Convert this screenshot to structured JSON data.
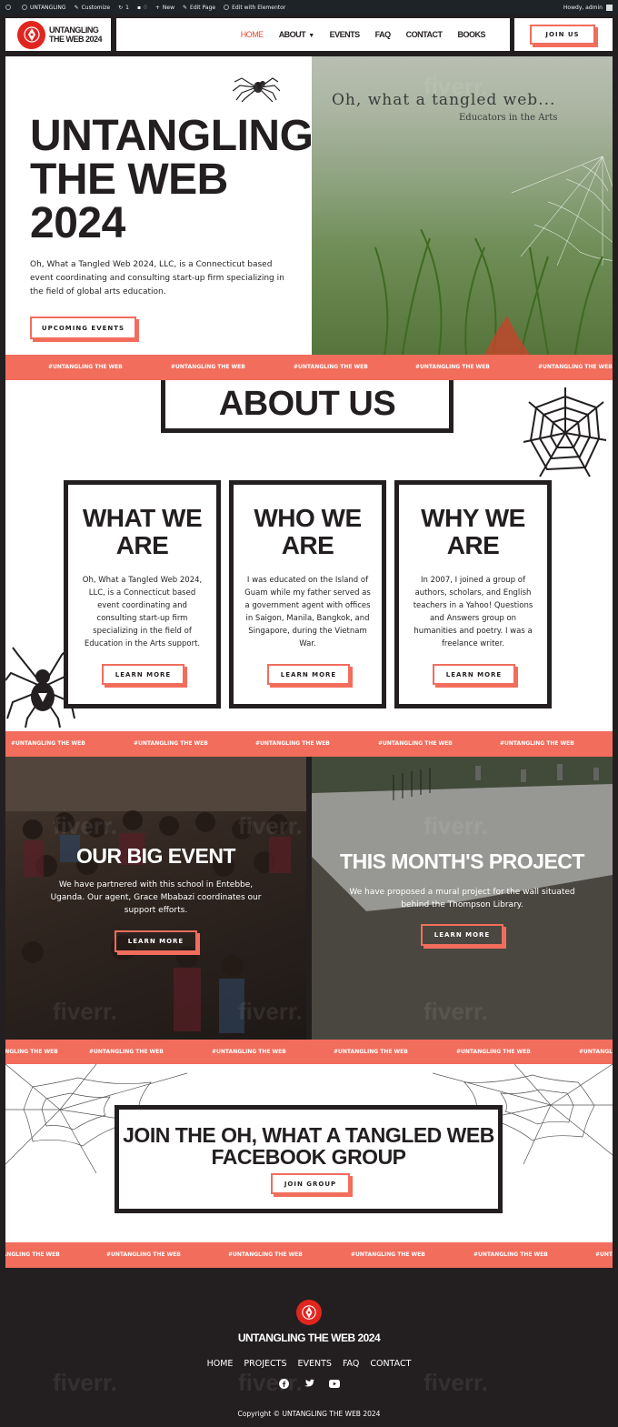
{
  "admin_bar": {
    "site": "UNTANGLING",
    "customize": "Customize",
    "updates": "1",
    "comments": "0",
    "new": "New",
    "edit_page": "Edit Page",
    "edit_elementor": "Edit with Elementor",
    "howdy": "Howdy, admin"
  },
  "header": {
    "logo_line1": "UNTANGLING",
    "logo_line2": "THE WEB 2024",
    "nav": [
      "HOME",
      "ABOUT",
      "EVENTS",
      "FAQ",
      "CONTACT",
      "BOOKS"
    ],
    "join_label": "JOIN US"
  },
  "hero": {
    "title_line1": "UNTANGLING",
    "title_line2": "THE WEB",
    "title_line3": "2024",
    "text": "Oh, What a Tangled Web 2024, LLC, is a Connecticut based event coordinating and consulting start-up firm specializing in the field of global arts education.",
    "button": "UPCOMING EVENTS",
    "image_quote": "Oh, what a tangled web...",
    "image_sub": "Educators in the Arts"
  },
  "marquee_text": "#UNTANGLING THE WEB",
  "about": {
    "title": "ABOUT US",
    "cards": [
      {
        "title_l1": "WHAT WE",
        "title_l2": "ARE",
        "text": "Oh, What a Tangled Web 2024, LLC, is a Connecticut based event coordinating and consulting start-up firm specializing in the field of Education in the Arts support.",
        "button": "LEARN MORE"
      },
      {
        "title_l1": "WHO WE",
        "title_l2": "ARE",
        "text": "I was educated on the Island of Guam while my father served as a government agent with offices in Saigon, Manila, Bangkok, and Singapore, during the Vietnam War.",
        "button": "LEARN MORE"
      },
      {
        "title_l1": "WHY WE",
        "title_l2": "ARE",
        "text": "In 2007, I joined a group of authors, scholars, and English teachers in a Yahoo! Questions and Answers group on humanities and poetry. I was a freelance writer.",
        "button": "LEARN MORE"
      }
    ]
  },
  "events": {
    "left_title": "OUR BIG EVENT",
    "left_text": "We have partnered with this school in Entebbe, Uganda. Our agent, Grace Mbabazi coordinates our support efforts.",
    "left_button": "LEARN MORE",
    "right_title": "THIS MONTH'S PROJECT",
    "right_text": "We have proposed a mural project for the wall situated behind the Thompson Library.",
    "right_button": "LEARN MORE"
  },
  "join": {
    "title_l1": "JOIN THE OH, WHAT A TANGLED WEB",
    "title_l2": "FACEBOOK GROUP",
    "button": "JOIN GROUP"
  },
  "footer": {
    "title": "UNTANGLING THE WEB 2024",
    "nav": [
      "HOME",
      "PROJECTS",
      "EVENTS",
      "FAQ",
      "CONTACT"
    ],
    "copyright": "Copyright © UNTANGLING THE WEB 2024"
  },
  "watermark": "fiverr.",
  "colors": {
    "accent": "#f26d5c",
    "dark": "#231f20",
    "logo_red": "#e0261f"
  }
}
